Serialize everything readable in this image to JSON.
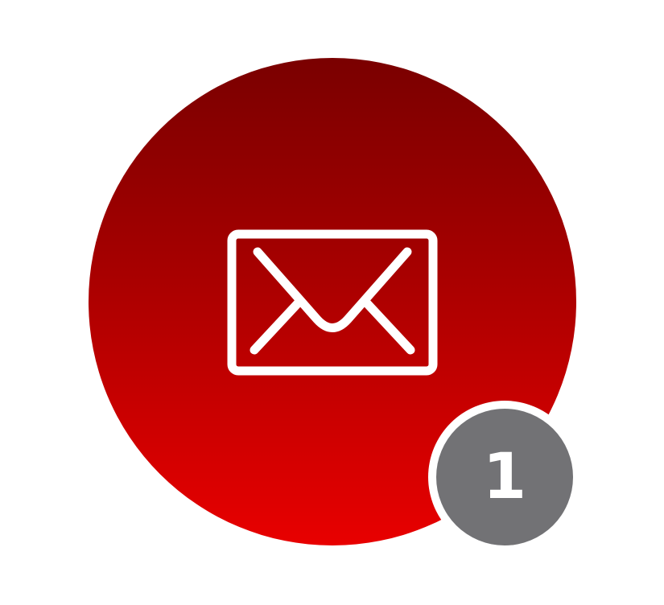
{
  "notification": {
    "icon": "envelope-icon",
    "badge_count": "1",
    "colors": {
      "circle_top": "#7a0000",
      "circle_bottom": "#e80000",
      "badge_background": "#727275",
      "foreground": "#ffffff"
    }
  }
}
